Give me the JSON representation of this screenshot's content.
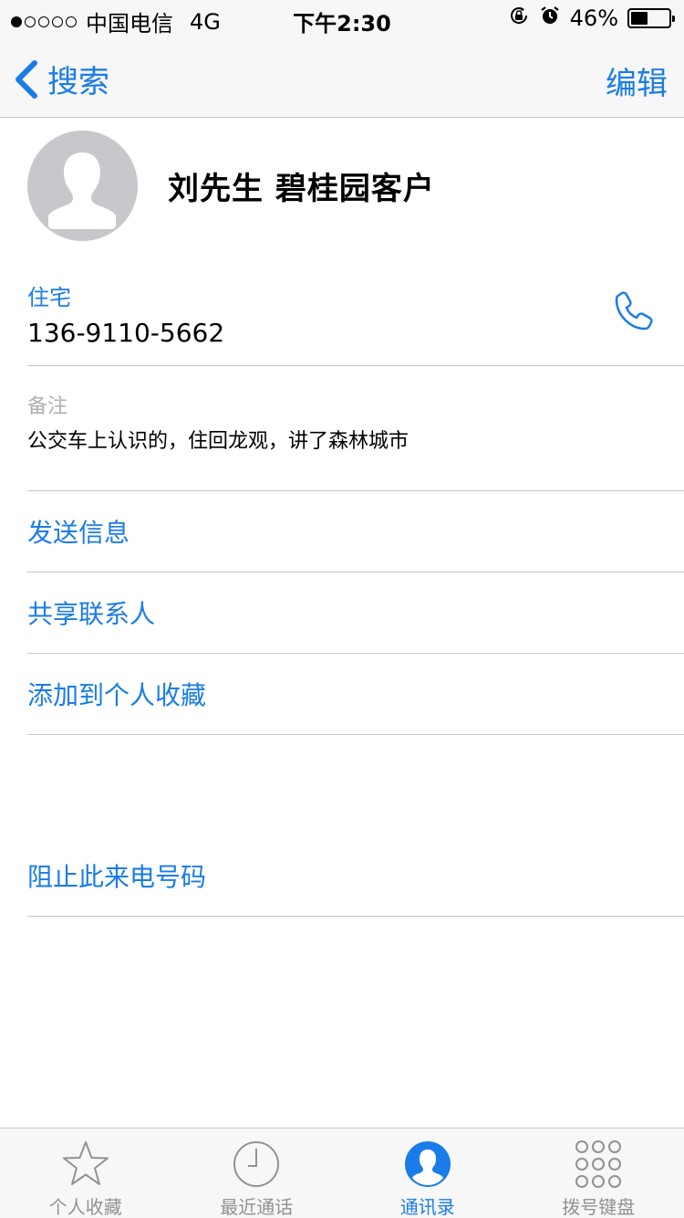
{
  "status_bar": {
    "carrier": "中国电信",
    "network": "4G",
    "time": "下午2:30",
    "battery_percent_text": "46%",
    "battery_level": 0.46,
    "signal_bars_filled": 1,
    "signal_bars_total": 5
  },
  "nav": {
    "back_label": "搜索",
    "edit_label": "编辑"
  },
  "contact": {
    "name": "刘先生  碧桂园客户",
    "phone_label": "住宅",
    "phone_number": "136-9110-5662",
    "notes_label": "备注",
    "notes_text": "公交车上认识的，住回龙观，讲了森林城市"
  },
  "actions": {
    "send_message": "发送信息",
    "share_contact": "共享联系人",
    "add_favorite": "添加到个人收藏",
    "block_caller": "阻止此来电号码"
  },
  "tabs": [
    {
      "label": "个人收藏",
      "icon": "star-icon",
      "active": false
    },
    {
      "label": "最近通话",
      "icon": "clock-icon",
      "active": false
    },
    {
      "label": "通讯录",
      "icon": "contacts-icon",
      "active": true
    },
    {
      "label": "拨号键盘",
      "icon": "keypad-icon",
      "active": false
    }
  ],
  "colors": {
    "accent": "#1a7ce9",
    "separator": "#c8c7cc",
    "inactive_tab": "#929292",
    "notes_label": "#b0b0b4",
    "bar_background": "#f7f7f7"
  }
}
